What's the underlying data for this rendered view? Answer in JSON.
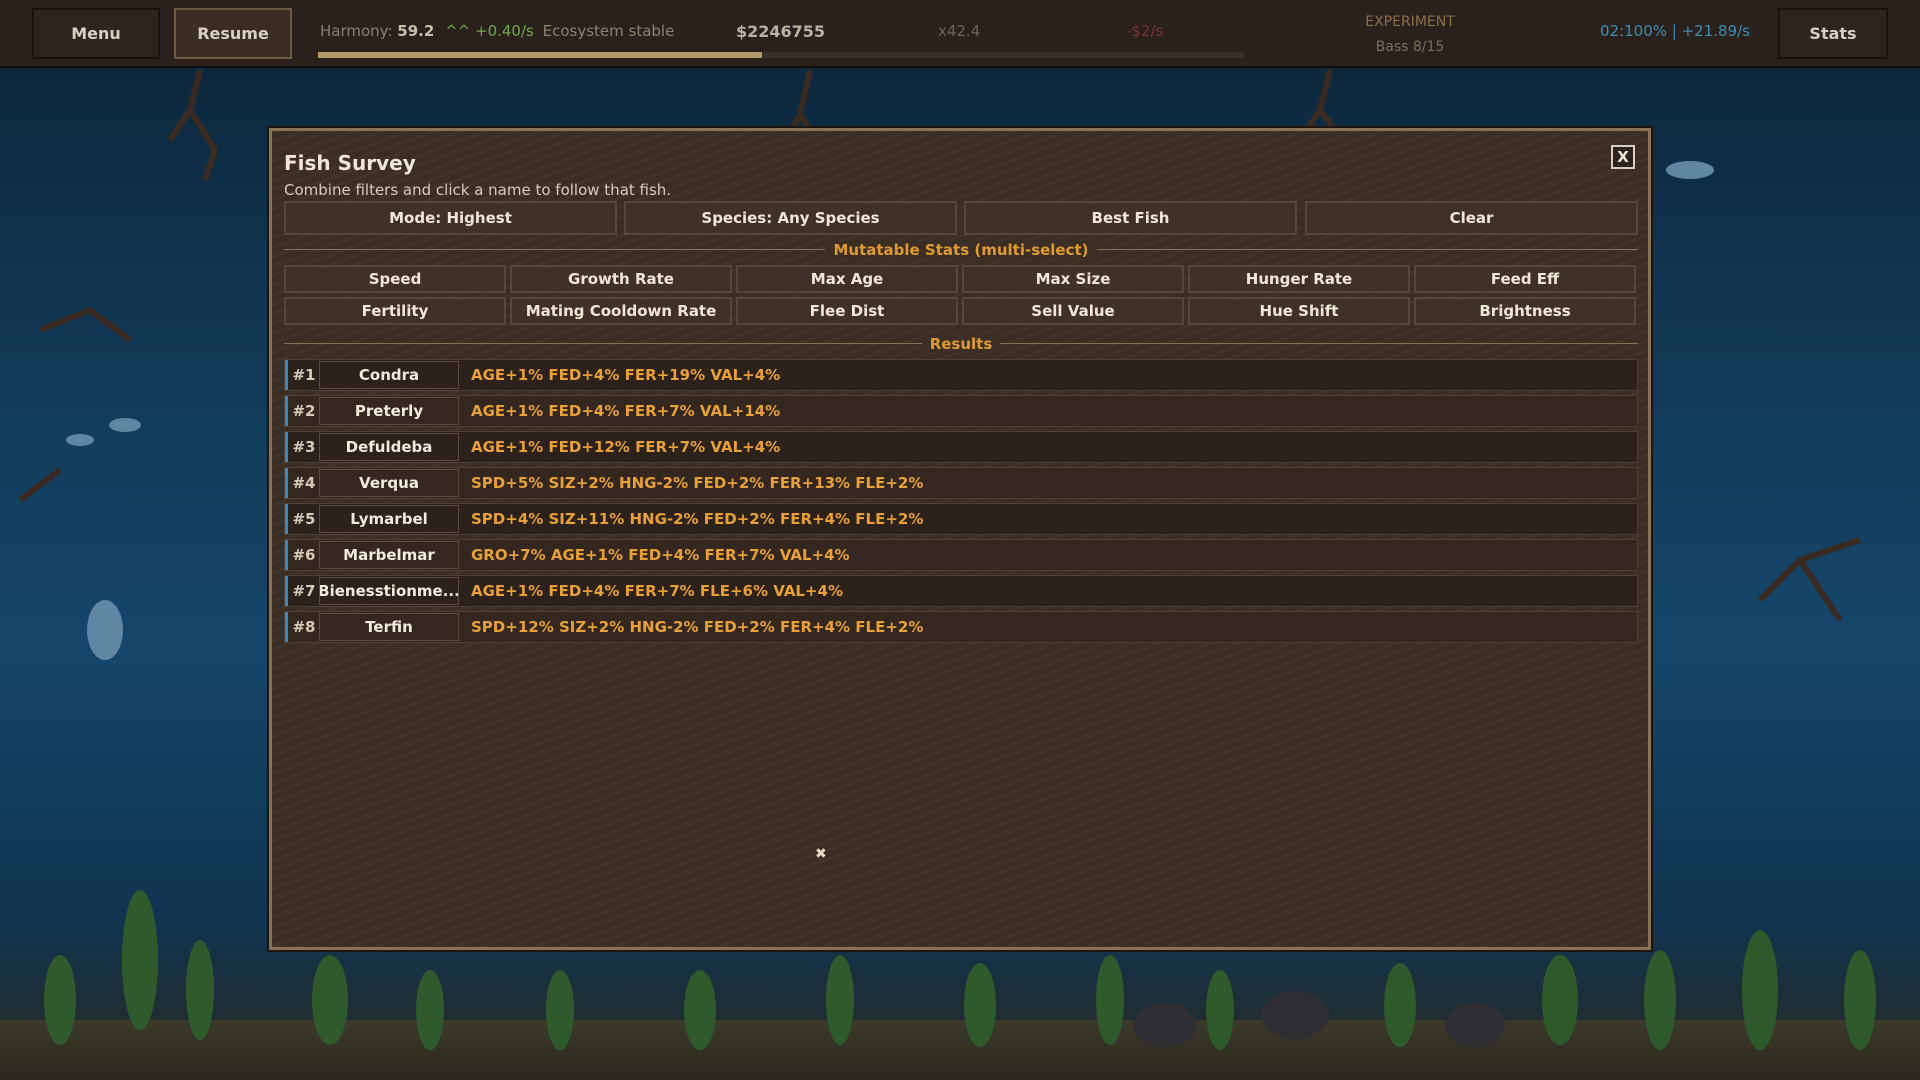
{
  "topbar": {
    "menu_label": "Menu",
    "resume_label": "Resume",
    "stats_label": "Stats",
    "harmony_label": "Harmony:",
    "harmony_value": "59.2",
    "harmony_rate": "^^ +0.40/s",
    "harmony_status": "Ecosystem stable",
    "harmony_progress": 0.48,
    "money": "$2246755",
    "multiplier": "x42.4",
    "money_rate": "-$2/s",
    "experiment_title": "EXPERIMENT",
    "experiment_sub": "Bass 8/15",
    "timer": "02:100% | +21.89/s"
  },
  "modal": {
    "title": "Fish Survey",
    "subtitle": "Combine filters and click a name to follow that fish.",
    "close_label": "X",
    "filters": [
      "Mode: Highest",
      "Species: Any Species",
      "Best Fish",
      "Clear"
    ],
    "mutable_heading": "Mutatable Stats (multi-select)",
    "stat_buttons": [
      "Speed",
      "Growth Rate",
      "Max Age",
      "Max Size",
      "Hunger Rate",
      "Feed Eff",
      "Fertility",
      "Mating Cooldown Rate",
      "Flee Dist",
      "Sell Value",
      "Hue Shift",
      "Brightness"
    ],
    "results_heading": "Results",
    "results": [
      {
        "rank": "#1",
        "name": "Condra",
        "stats": "AGE+1%  FED+4%  FER+19%  VAL+4%"
      },
      {
        "rank": "#2",
        "name": "Preterly",
        "stats": "AGE+1%  FED+4%  FER+7%  VAL+14%"
      },
      {
        "rank": "#3",
        "name": "Defuldeba",
        "stats": "AGE+1%  FED+12%  FER+7%  VAL+4%"
      },
      {
        "rank": "#4",
        "name": "Verqua",
        "stats": "SPD+5%  SIZ+2%  HNG-2%  FED+2%  FER+13%  FLE+2%"
      },
      {
        "rank": "#5",
        "name": "Lymarbel",
        "stats": "SPD+4%  SIZ+11%  HNG-2%  FED+2%  FER+4%  FLE+2%"
      },
      {
        "rank": "#6",
        "name": "Marbelmar",
        "stats": "GRO+7%  AGE+1%  FED+4%  FER+7%  VAL+4%"
      },
      {
        "rank": "#7",
        "name": "Bienesstionme...",
        "stats": "AGE+1%  FED+4%  FER+7%  FLE+6%  VAL+4%"
      },
      {
        "rank": "#8",
        "name": "Terfin",
        "stats": "SPD+12%  SIZ+2%  HNG-2%  FED+2%  FER+4%  FLE+2%"
      }
    ],
    "cursor_glyph": "✖"
  },
  "colors": {
    "accent_orange": "#e8a03a",
    "accent_blue": "#3f86c0",
    "panel_bg": "#3b2e25",
    "harmony_green": "#6fa64a"
  }
}
